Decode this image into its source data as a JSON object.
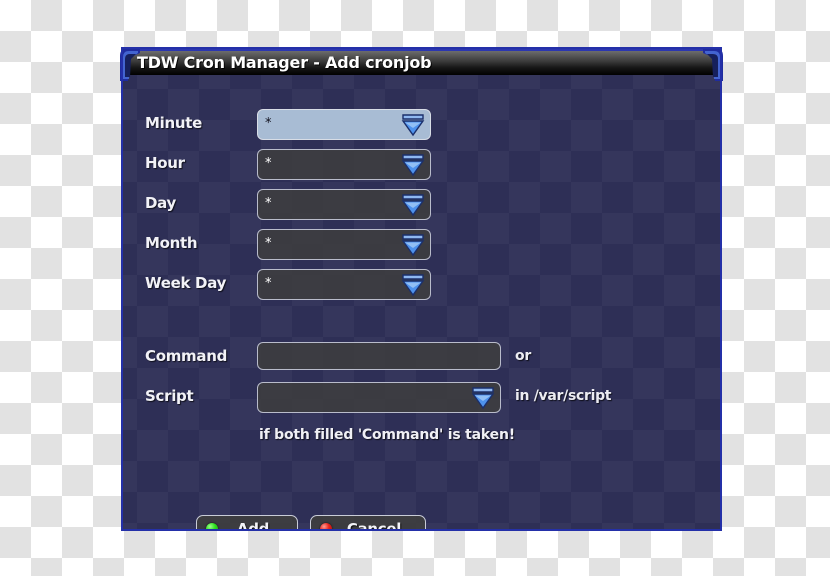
{
  "window": {
    "title": "TDW Cron Manager - Add cronjob",
    "corner_icon_left": "window-corner-ornament-icon",
    "corner_icon_right": "window-corner-ornament-icon"
  },
  "form": {
    "fields": [
      {
        "label": "Minute",
        "value": "*",
        "type": "dropdown",
        "focused": true,
        "icon": "chevron-down-icon"
      },
      {
        "label": "Hour",
        "value": "*",
        "type": "dropdown",
        "focused": false,
        "icon": "chevron-down-icon"
      },
      {
        "label": "Day",
        "value": "*",
        "type": "dropdown",
        "focused": false,
        "icon": "chevron-down-icon"
      },
      {
        "label": "Month",
        "value": "*",
        "type": "dropdown",
        "focused": false,
        "icon": "chevron-down-icon"
      },
      {
        "label": "Week Day",
        "value": "*",
        "type": "dropdown",
        "focused": false,
        "icon": "chevron-down-icon"
      }
    ],
    "command": {
      "label": "Command",
      "value": "",
      "placeholder": "",
      "suffix": "or"
    },
    "script": {
      "label": "Script",
      "value": "",
      "suffix": "in /var/script",
      "icon": "chevron-down-icon"
    },
    "hint": "if both filled 'Command' is taken!"
  },
  "buttons": {
    "add": {
      "label": "Add",
      "led": "green-led-icon",
      "led_color": "#2ee01e"
    },
    "cancel": {
      "label": "Cancel",
      "led": "red-led-icon",
      "led_color": "#e8231a"
    }
  },
  "colors": {
    "window_body": "#2e2f56",
    "window_border": "#2430a8",
    "field_bg": "#3e3e3e",
    "field_focus_bg": "#a8bcd4",
    "arrow_blue": "#3f7fe8",
    "title_text": "#ffffff"
  }
}
